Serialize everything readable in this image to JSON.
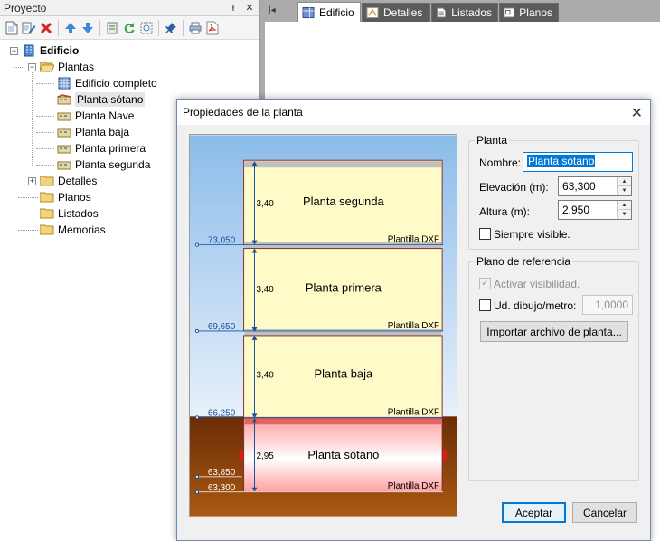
{
  "panel": {
    "title": "Proyecto",
    "pin_glyph": "ᵻ",
    "close_glyph": "✕"
  },
  "toolbar": {
    "icons": [
      "new-page-icon",
      "edit-icon",
      "delete-icon",
      "move-up-icon",
      "move-down-icon",
      "sheet-icon",
      "refresh-icon",
      "capture-icon",
      "pin-icon",
      "print-icon",
      "pdf-icon"
    ]
  },
  "tree": {
    "root": "Edificio",
    "plantas": "Plantas",
    "floors": [
      "Edificio completo",
      "Planta sótano",
      "Planta Nave",
      "Planta baja",
      "Planta primera",
      "Planta segunda"
    ],
    "folders": [
      "Detalles",
      "Planos",
      "Listados",
      "Memorias"
    ],
    "expand_glyph": "+",
    "collapse_glyph": "−"
  },
  "tabs": {
    "first_glyph": "|◂",
    "items": [
      "Edificio",
      "Detalles",
      "Listados",
      "Planos"
    ]
  },
  "dialog": {
    "title": "Propiedades de la planta",
    "close_glyph": "✕",
    "planta_group": {
      "legend": "Planta",
      "nombre_label": "Nombre:",
      "nombre_value": "Planta sótano",
      "elevacion_label": "Elevación (m):",
      "elevacion_value": "63,300",
      "altura_label": "Altura (m):",
      "altura_value": "2,950",
      "siempre_visible": "Siempre visible.",
      "spin_up": "▲",
      "spin_down": "▼"
    },
    "referencia_group": {
      "legend": "Plano de referencia",
      "activar": "Activar visibilidad.",
      "ud_label": "Ud. dibujo/metro:",
      "ud_value": "1,0000",
      "import_button": "Importar archivo de planta...",
      "check_glyph": "✓"
    },
    "buttons": {
      "accept": "Aceptar",
      "cancel": "Cancelar"
    }
  },
  "preview": {
    "sky_top": "#8bbcea",
    "sky_bottom": "#e7f1fa",
    "ground_top": "#6b2c05",
    "ground_bottom": "#a95a12",
    "floor_fill": "#fffbc8",
    "selected_gradient_top": "#ff9f9f",
    "selected_gradient_mid": "#ffffff",
    "slab_color": "#bfbfbf",
    "selected_slab_color": "#e06666",
    "template_label": "Plantilla DXF",
    "floors": [
      {
        "name": "Planta segunda",
        "height": "3,40",
        "base": "73,050"
      },
      {
        "name": "Planta primera",
        "height": "3,40",
        "base": "69,650"
      },
      {
        "name": "Planta baja",
        "height": "3,40",
        "base": "66,250"
      },
      {
        "name": "Planta sótano",
        "height": "2,95",
        "base": "63,300",
        "extra_level": "63,850"
      }
    ]
  }
}
